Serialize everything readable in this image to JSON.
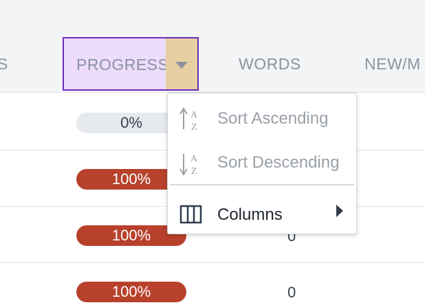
{
  "header": {
    "col_prev_fragment": "S",
    "progress_label": "PROGRESS",
    "words_label": "WORDS",
    "new_fragment": "NEW/M"
  },
  "rows": [
    {
      "progress": "0%",
      "words": ""
    },
    {
      "progress": "100%",
      "words": ""
    },
    {
      "progress": "100%",
      "words": "0"
    },
    {
      "progress": "100%",
      "words": "0"
    }
  ],
  "menu": {
    "sort_asc": "Sort Ascending",
    "sort_desc": "Sort Descending",
    "columns": "Columns",
    "icons": {
      "sort_asc": "sort-alpha-asc-icon",
      "sort_desc": "sort-alpha-desc-icon",
      "columns": "columns-icon",
      "submenu": "caret-right-icon",
      "toggle": "caret-down-icon"
    }
  },
  "colors": {
    "header_bg": "#f3f4f6",
    "active_header_bg": "#eddcfb",
    "active_header_border": "#6b2bb8",
    "toggle_bg": "#e7cfa4",
    "progress_full": "#b8412c",
    "progress_empty": "#e6e9ee"
  }
}
